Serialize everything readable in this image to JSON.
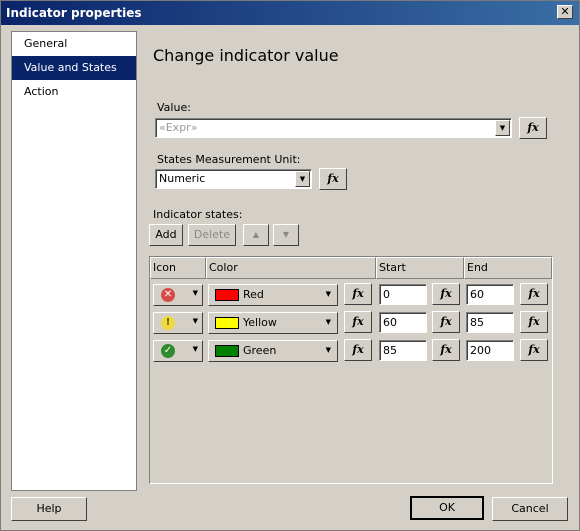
{
  "window": {
    "title": "Indicator properties",
    "close_glyph": "✕"
  },
  "nav": {
    "items": [
      {
        "label": "General",
        "selected": false
      },
      {
        "label": "Value and States",
        "selected": true
      },
      {
        "label": "Action",
        "selected": false
      }
    ]
  },
  "page": {
    "heading": "Change indicator value",
    "value_label": "Value:",
    "value_placeholder": "«Expr»",
    "unit_label": "States Measurement Unit:",
    "unit_value": "Numeric",
    "states_label": "Indicator states:",
    "fx_label": "fx"
  },
  "toolbar": {
    "add_label": "Add",
    "delete_label": "Delete",
    "up_glyph": "▲",
    "down_glyph": "▼"
  },
  "grid": {
    "columns": [
      "Icon",
      "Color",
      "Start",
      "End"
    ],
    "rows": [
      {
        "icon": "red-x-circle-icon",
        "icon_color": "#d94a4a",
        "icon_glyph": "✕",
        "color_name": "Red",
        "swatch": "#ff0000",
        "start": "0",
        "end": "60"
      },
      {
        "icon": "yellow-exclamation-circle-icon",
        "icon_color": "#f0d840",
        "icon_glyph": "!",
        "color_name": "Yellow",
        "swatch": "#ffff00",
        "start": "60",
        "end": "85"
      },
      {
        "icon": "green-check-circle-icon",
        "icon_color": "#2e8b2e",
        "icon_glyph": "✓",
        "color_name": "Green",
        "swatch": "#008000",
        "start": "85",
        "end": "200"
      }
    ]
  },
  "footer": {
    "help_label": "Help",
    "ok_label": "OK",
    "cancel_label": "Cancel"
  }
}
